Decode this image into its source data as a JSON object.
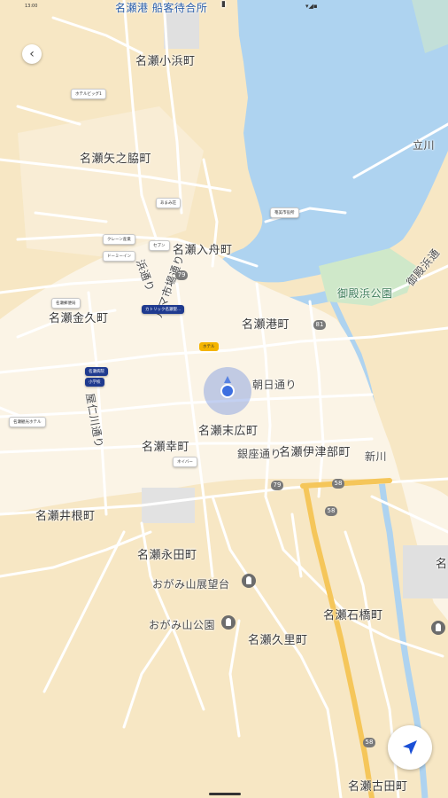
{
  "status_bar": {
    "time": "13:00"
  },
  "top_label": "名瀬港 船客待合所",
  "place_labels": {
    "irifunecho_top": "名瀬入舟町... ",
    "kohama": "名瀬小浜町",
    "yanowaki": "名瀬矢之脇町",
    "irifune": "名瀬入舟町",
    "minato": "名瀬港町",
    "kanakuhama": "名瀬金久町",
    "suehiro": "名瀬末広町",
    "saiwai": "名瀬幸町",
    "izubu": "名瀬伊津部町",
    "inene": "名瀬井根町",
    "nagata": "名瀬永田町",
    "ishibashi": "名瀬石橋町",
    "kuri": "名瀬久里町",
    "furuta": "名瀬古田町",
    "ogamiyama_view": "おがみ山展望台",
    "ogamiyama_park": "おがみ山公園",
    "goden_park": "御殿浜公園",
    "shinkawa": "新川",
    "asahi_dori": "朝日通り",
    "ginza_dori": "銀座通り",
    "yatachi": "屋仁川通り",
    "yui_dori": "ルマ市場通り",
    "shimo_dori": "浜通り",
    "tachigawa": "立川",
    "shimogawa": "御殿浜通",
    "right_edge": "名"
  },
  "route_shields": [
    "79",
    "79",
    "81",
    "58",
    "58",
    "58"
  ],
  "pins_white": [
    "ホテルビッグ1",
    "あまみ荘",
    "クレーン産業",
    "ドーミーイン",
    "セブン",
    "名瀬郵便局",
    "奄美市役所",
    "名瀬観光ホテル",
    "ネイバー"
  ],
  "pins_blue": [
    "カトリック名瀬聖...",
    "名瀬病院",
    "小学校"
  ],
  "pins_yellow": [
    "ホテル"
  ],
  "icons": [
    "back-icon",
    "navigation-arrow-icon",
    "camera-icon",
    "park-icon"
  ]
}
